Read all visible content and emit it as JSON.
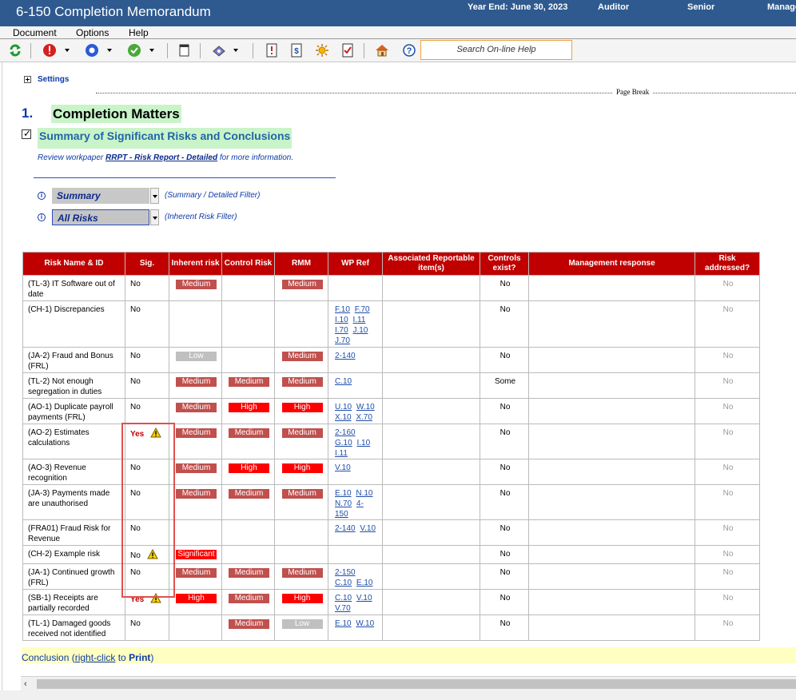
{
  "titlebar": {
    "title": "6-150 Completion Memorandum",
    "year_end": "Year End: June 30, 2023",
    "auditor": "Auditor",
    "senior": "Senior",
    "manager": "Manage"
  },
  "menu": [
    "Document",
    "Options",
    "Help"
  ],
  "toolbar": {
    "search_placeholder": "Search On-line Help",
    "icons": [
      "refresh-icon",
      "error-icon",
      "circle-icon",
      "check-icon",
      "page-icon",
      "stamp-icon",
      "info-doc-icon",
      "dollar-doc-icon",
      "sun-icon",
      "checklist-icon",
      "home-icon",
      "help-icon"
    ]
  },
  "settings": "Settings",
  "page_break": "Page Break",
  "section": {
    "number": "1.",
    "title": "Completion Matters"
  },
  "subsection": {
    "title": "Summary of Significant Risks and Conclusions"
  },
  "review": {
    "prefix": "Review workpaper ",
    "link": "RRPT - Risk Report - Detailed",
    "suffix": " for more information."
  },
  "filters": [
    {
      "value": "Summary",
      "note": "(Summary / Detailed Filter)"
    },
    {
      "value": "All Risks",
      "note": "(Inherent Risk Filter)"
    }
  ],
  "table": {
    "headers": [
      "Risk Name & ID",
      "Sig.",
      "Inherent risk",
      "Control Risk",
      "RMM",
      "WP Ref",
      "Associated Reportable item(s)",
      "Controls exist?",
      "Management response",
      "Risk addressed?"
    ],
    "rows": [
      {
        "name": "(TL-3) IT Software out of date",
        "sig": "No",
        "warn": false,
        "inherent": "Medium",
        "control": "",
        "rmm": "Medium",
        "wp": [],
        "assoc": "",
        "controls": "No",
        "mgmt": "",
        "addressed": "No"
      },
      {
        "name": "(CH-1) Discrepancies",
        "sig": "No",
        "warn": false,
        "inherent": "",
        "control": "",
        "rmm": "",
        "wp": [
          "F.10",
          "F.70",
          "I.10",
          "I.11",
          "I.70",
          "J.10",
          "J.70"
        ],
        "assoc": "",
        "controls": "No",
        "mgmt": "",
        "addressed": "No"
      },
      {
        "name": "(JA-2) Fraud and Bonus (FRL)",
        "sig": "No",
        "warn": false,
        "inherent": "Low",
        "control": "",
        "rmm": "Medium",
        "wp": [
          "2-140"
        ],
        "assoc": "",
        "controls": "No",
        "mgmt": "",
        "addressed": "No"
      },
      {
        "name": "(TL-2) Not enough segregation in duties",
        "sig": "No",
        "warn": false,
        "inherent": "Medium",
        "control": "Medium",
        "rmm": "Medium",
        "wp": [
          "C.10"
        ],
        "assoc": "",
        "controls": "Some",
        "mgmt": "",
        "addressed": "No"
      },
      {
        "name": "(AO-1) Duplicate payroll payments (FRL)",
        "sig": "No",
        "warn": false,
        "inherent": "Medium",
        "control": "High",
        "rmm": "High",
        "wp": [
          "U.10",
          "W.10",
          "X.10",
          "X.70"
        ],
        "assoc": "",
        "controls": "No",
        "mgmt": "",
        "addressed": "No"
      },
      {
        "name": "(AO-2) Estimates calculations",
        "sig": "Yes",
        "warn": true,
        "inherent": "Medium",
        "control": "Medium",
        "rmm": "Medium",
        "wp": [
          "2-160",
          "G.10",
          "I.10",
          "I.11"
        ],
        "assoc": "",
        "controls": "No",
        "mgmt": "",
        "addressed": "No"
      },
      {
        "name": "(AO-3) Revenue recognition",
        "sig": "No",
        "warn": false,
        "inherent": "Medium",
        "control": "High",
        "rmm": "High",
        "wp": [
          "V.10"
        ],
        "assoc": "",
        "controls": "No",
        "mgmt": "",
        "addressed": "No"
      },
      {
        "name": "(JA-3) Payments made are unauthorised",
        "sig": "No",
        "warn": false,
        "inherent": "Medium",
        "control": "Medium",
        "rmm": "Medium",
        "wp": [
          "E.10",
          "N.10",
          "N.70",
          "4-150"
        ],
        "assoc": "",
        "controls": "No",
        "mgmt": "",
        "addressed": "No"
      },
      {
        "name": "(FRA01) Fraud Risk for Revenue",
        "sig": "No",
        "warn": false,
        "inherent": "",
        "control": "",
        "rmm": "",
        "wp": [
          "2-140",
          "V.10"
        ],
        "assoc": "",
        "controls": "No",
        "mgmt": "",
        "addressed": "No"
      },
      {
        "name": "(CH-2) Example risk",
        "sig": "No",
        "warn": true,
        "inherent": "Significant",
        "control": "",
        "rmm": "",
        "wp": [],
        "assoc": "",
        "controls": "No",
        "mgmt": "",
        "addressed": "No"
      },
      {
        "name": "(JA-1) Continued growth (FRL)",
        "sig": "No",
        "warn": false,
        "inherent": "Medium",
        "control": "Medium",
        "rmm": "Medium",
        "wp": [
          "2-150",
          "C.10",
          "E.10"
        ],
        "assoc": "",
        "controls": "No",
        "mgmt": "",
        "addressed": "No"
      },
      {
        "name": "(SB-1) Receipts are partially recorded",
        "sig": "Yes",
        "warn": true,
        "inherent": "High",
        "control": "Medium",
        "rmm": "High",
        "wp": [
          "C.10",
          "V.10",
          "V.70"
        ],
        "assoc": "",
        "controls": "No",
        "mgmt": "",
        "addressed": "No"
      },
      {
        "name": "(TL-1) Damaged goods received not identified",
        "sig": "No",
        "warn": false,
        "inherent": "",
        "control": "Medium",
        "rmm": "Low",
        "wp": [
          "E.10",
          "W.10"
        ],
        "assoc": "",
        "controls": "No",
        "mgmt": "",
        "addressed": "No"
      }
    ]
  },
  "conclusion": {
    "prefix": "Conclusion (",
    "link": "right-click",
    "mid": " to ",
    "bold": "Print",
    "suffix": ")"
  }
}
